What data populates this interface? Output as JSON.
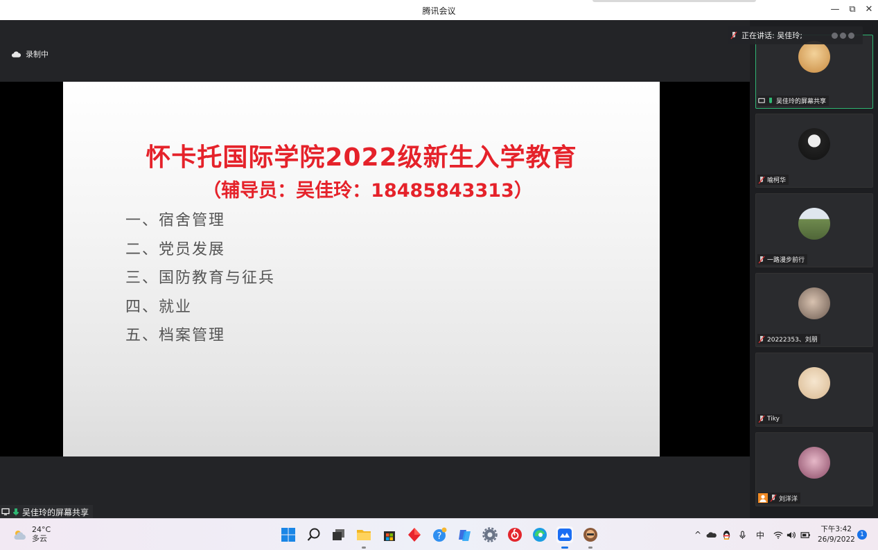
{
  "window": {
    "title": "腾讯会议",
    "controls": {
      "minimize": "—",
      "restore": "⧉",
      "close": "✕"
    }
  },
  "meeting": {
    "recording_label": "录制中",
    "speaking_label": "正在讲话: 吴佳玲;",
    "share_label": "吴佳玲的屏幕共享"
  },
  "slide": {
    "title": "怀卡托国际学院2022级新生入学教育",
    "subtitle": "（辅导员：吴佳玲：18485843313）",
    "items": [
      "一、宿舍管理",
      "二、党员发展",
      "三、国防教育与征兵",
      "四、就业",
      "五、档案管理"
    ]
  },
  "participants": [
    {
      "name": "吴佳玲的屏幕共享",
      "icon": "screen-share-icon",
      "mic": "active",
      "avatar_color": "#d9a55a"
    },
    {
      "name": "喻柯华",
      "mic": "muted",
      "avatar_color": "#3a3a3a"
    },
    {
      "name": "一路漫步前行",
      "mic": "muted",
      "avatar_color": "#7a8d5a"
    },
    {
      "name": "20222353、刘朋",
      "mic": "muted",
      "avatar_color": "#a08a7a"
    },
    {
      "name": "Tiky",
      "mic": "muted",
      "avatar_color": "#e8d4b8"
    },
    {
      "name": "刘洋洋",
      "mic": "muted",
      "icon": "user-avatar-icon",
      "avatar_color": "#b06a88"
    }
  ],
  "taskbar": {
    "weather_temp": "24°C",
    "weather_desc": "多云",
    "apps": [
      "start-icon",
      "search-icon",
      "task-view-icon",
      "file-explorer-icon",
      "store-icon",
      "red-app-icon",
      "help-icon",
      "copilot-icon",
      "settings-icon",
      "netease-music-icon",
      "edge-icon",
      "tencent-meeting-icon",
      "avatar-app-icon"
    ],
    "tray": {
      "ime": "中"
    },
    "clock_time": "下午3:42",
    "clock_date": "26/9/2022",
    "notifications": "1"
  },
  "colors": {
    "slide_accent": "#e5222a",
    "active_speaker": "#2fb673",
    "focus": "#1a73e8"
  }
}
